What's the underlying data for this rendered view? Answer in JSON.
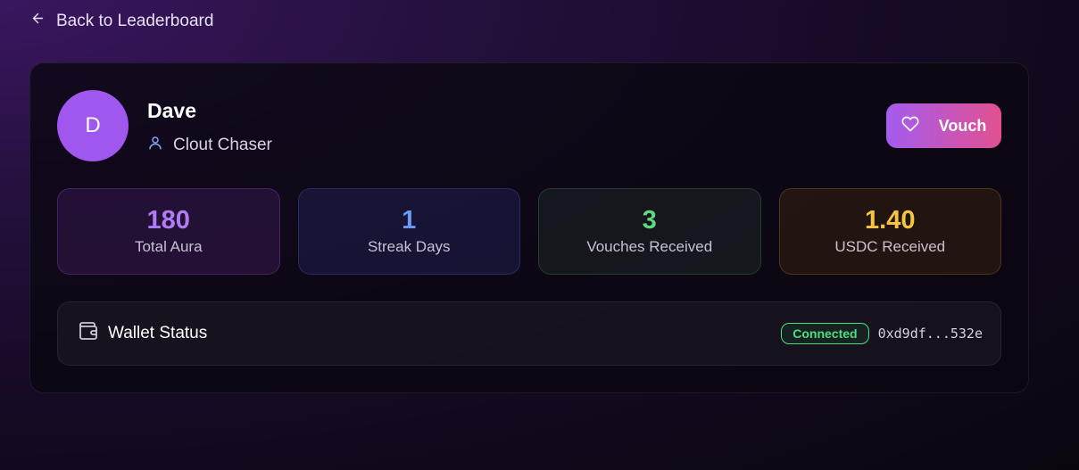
{
  "nav": {
    "back_label": "Back to Leaderboard"
  },
  "profile": {
    "avatar_initial": "D",
    "avatar_color": "#a057f0",
    "name": "Dave",
    "role": "Clout Chaser"
  },
  "actions": {
    "vouch_label": "Vouch"
  },
  "stats": [
    {
      "value": "180",
      "label": "Total Aura",
      "color": "#b07cf5"
    },
    {
      "value": "1",
      "label": "Streak Days",
      "color": "#6b9bf5"
    },
    {
      "value": "3",
      "label": "Vouches Received",
      "color": "#5fd883"
    },
    {
      "value": "1.40",
      "label": "USDC Received",
      "color": "#f5c542"
    }
  ],
  "wallet": {
    "title": "Wallet Status",
    "status": "Connected",
    "status_color": "#4ade80",
    "address": "0xd9df...532e"
  },
  "icons": {
    "back": "arrow-left-icon",
    "role": "user-icon",
    "vouch": "heart-icon",
    "wallet": "wallet-icon"
  }
}
